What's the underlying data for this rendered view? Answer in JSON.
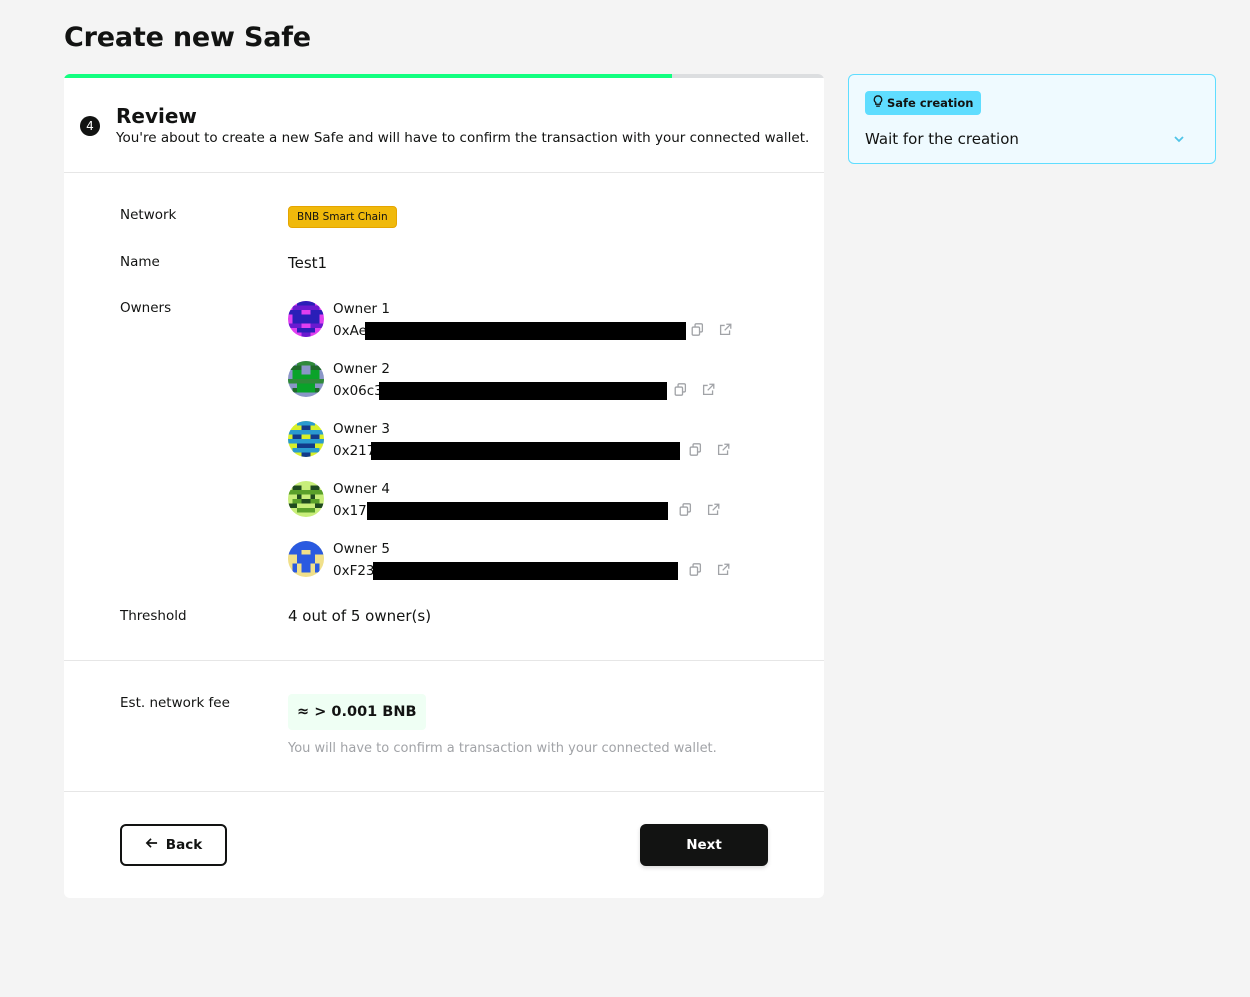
{
  "page": {
    "title": "Create new Safe"
  },
  "progress": {
    "fraction": 0.8
  },
  "step": {
    "number": "4",
    "title": "Review",
    "subtitle": "You're about to create a new Safe and will have to confirm the transaction with your connected wallet."
  },
  "review": {
    "network_label": "Network",
    "network_value": "BNB Smart Chain",
    "network_color": "#F0B90B",
    "name_label": "Name",
    "name_value": "Test1",
    "owners_label": "Owners",
    "owners": [
      {
        "name": "Owner 1",
        "address": "0xAe"
      },
      {
        "name": "Owner 2",
        "address": "0x06c3"
      },
      {
        "name": "Owner 3",
        "address": "0x217"
      },
      {
        "name": "Owner 4",
        "address": "0x177"
      },
      {
        "name": "Owner 5",
        "address": "0xF23"
      }
    ],
    "threshold_label": "Threshold",
    "threshold_value": "4 out of 5 owner(s)"
  },
  "fee": {
    "label": "Est. network fee",
    "value": "≈ > 0.001 BNB",
    "hint": "You will have to confirm a transaction with your connected wallet."
  },
  "buttons": {
    "back": "Back",
    "next": "Next"
  },
  "status": {
    "chip": "Safe creation",
    "text": "Wait for the creation",
    "accent": "#5FDDFF"
  },
  "icons": {
    "copy": "copy-icon",
    "external": "external-link-icon",
    "back": "arrow-left-icon",
    "status": "lightbulb-icon",
    "expand": "chevron-down-icon"
  }
}
